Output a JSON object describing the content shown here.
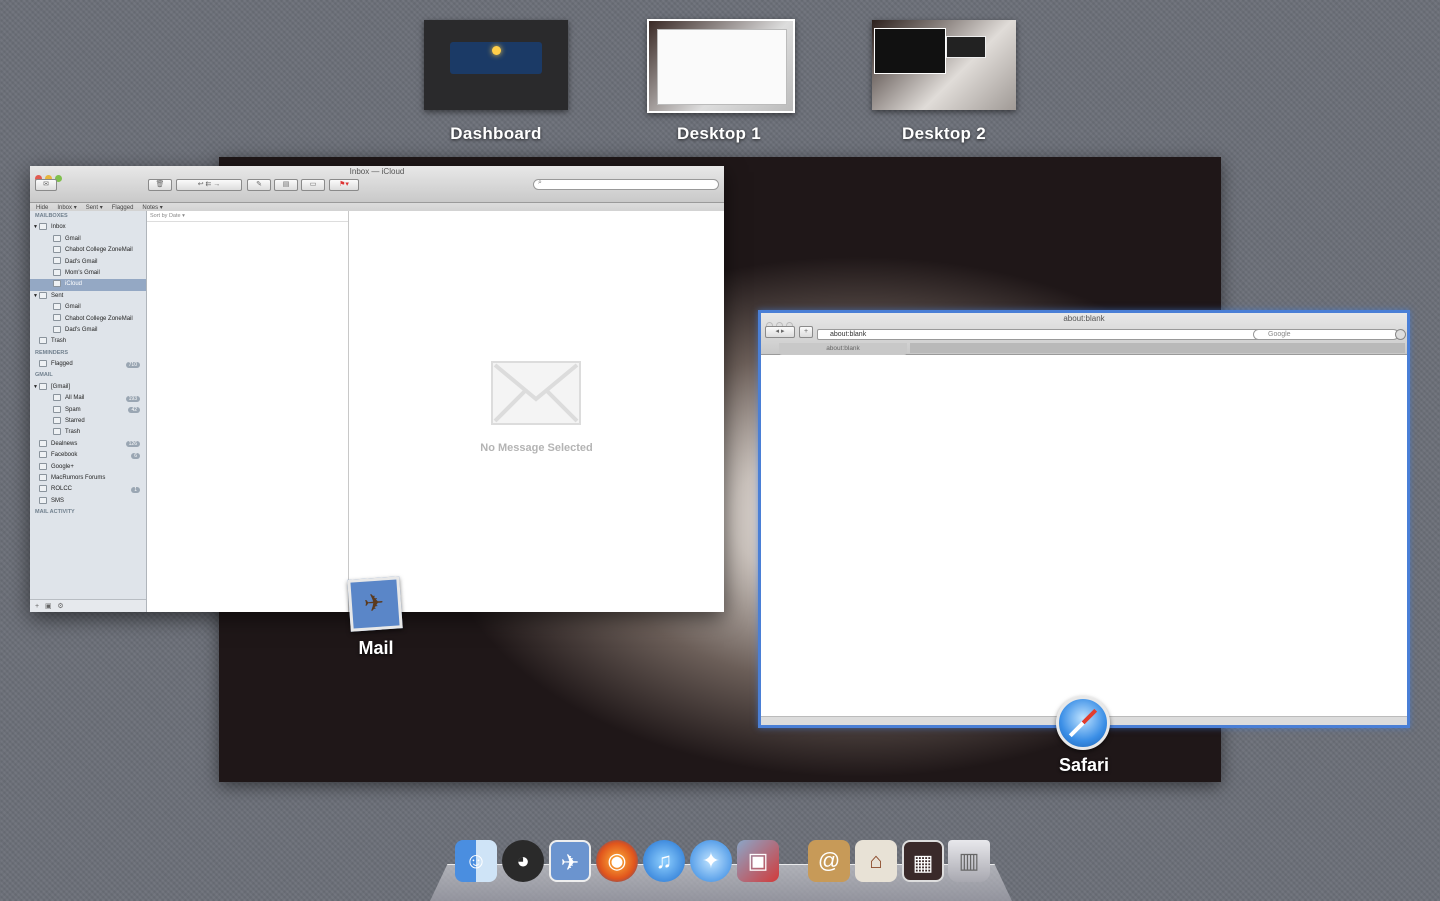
{
  "spaces": [
    {
      "label": "Dashboard"
    },
    {
      "label": "Desktop 1"
    },
    {
      "label": "Desktop 2"
    }
  ],
  "mail": {
    "app_label": "Mail",
    "title": "Inbox — iCloud",
    "favorites": [
      "Hide",
      "Inbox ▾",
      "Sent ▾",
      "Flagged",
      "Notes ▾"
    ],
    "sort_label": "Sort by Date ▾",
    "no_message": "No Message Selected",
    "sidebar": [
      {
        "type": "head",
        "label": "MAILBOXES"
      },
      {
        "type": "item",
        "label": "Inbox",
        "indent": 1,
        "tri": "▼"
      },
      {
        "type": "item",
        "label": "Gmail",
        "indent": 2
      },
      {
        "type": "item",
        "label": "Chabot College ZoneMail",
        "indent": 2
      },
      {
        "type": "item",
        "label": "Dad's Gmail",
        "indent": 2
      },
      {
        "type": "item",
        "label": "Mom's Gmail",
        "indent": 2
      },
      {
        "type": "item",
        "label": "iCloud",
        "indent": 2,
        "selected": true
      },
      {
        "type": "item",
        "label": "Sent",
        "indent": 1,
        "tri": "▼"
      },
      {
        "type": "item",
        "label": "Gmail",
        "indent": 2
      },
      {
        "type": "item",
        "label": "Chabot College ZoneMail",
        "indent": 2
      },
      {
        "type": "item",
        "label": "Dad's Gmail",
        "indent": 2
      },
      {
        "type": "item",
        "label": "Trash",
        "indent": 1
      },
      {
        "type": "head",
        "label": "REMINDERS"
      },
      {
        "type": "item",
        "label": "Flagged",
        "indent": 1,
        "badge": "710"
      },
      {
        "type": "head",
        "label": "GMAIL"
      },
      {
        "type": "item",
        "label": "[Gmail]",
        "indent": 1,
        "tri": "▼"
      },
      {
        "type": "item",
        "label": "All Mail",
        "indent": 2,
        "badge": "193"
      },
      {
        "type": "item",
        "label": "Spam",
        "indent": 2,
        "badge": "42"
      },
      {
        "type": "item",
        "label": "Starred",
        "indent": 2
      },
      {
        "type": "item",
        "label": "Trash",
        "indent": 2
      },
      {
        "type": "item",
        "label": "Dealnews",
        "indent": 1,
        "badge": "126"
      },
      {
        "type": "item",
        "label": "Facebook",
        "indent": 1,
        "badge": "6"
      },
      {
        "type": "item",
        "label": "Google+",
        "indent": 1
      },
      {
        "type": "item",
        "label": "MacRumors Forums",
        "indent": 1
      },
      {
        "type": "item",
        "label": "ROLCC",
        "indent": 1,
        "badge": "1"
      },
      {
        "type": "item",
        "label": "SMS",
        "indent": 1
      },
      {
        "type": "head",
        "label": "MAIL ACTIVITY"
      }
    ]
  },
  "safari": {
    "app_label": "Safari",
    "title": "about:blank",
    "url": "about:blank",
    "search_placeholder": "Google",
    "tab_label": "about:blank"
  },
  "dock": [
    "finder-icon",
    "adium-icon",
    "mail-icon",
    "firefox-icon",
    "itunes-icon",
    "safari-icon",
    "parallels-icon",
    "addressbook-icon",
    "home-icon",
    "photo-icon",
    "trash-icon"
  ]
}
